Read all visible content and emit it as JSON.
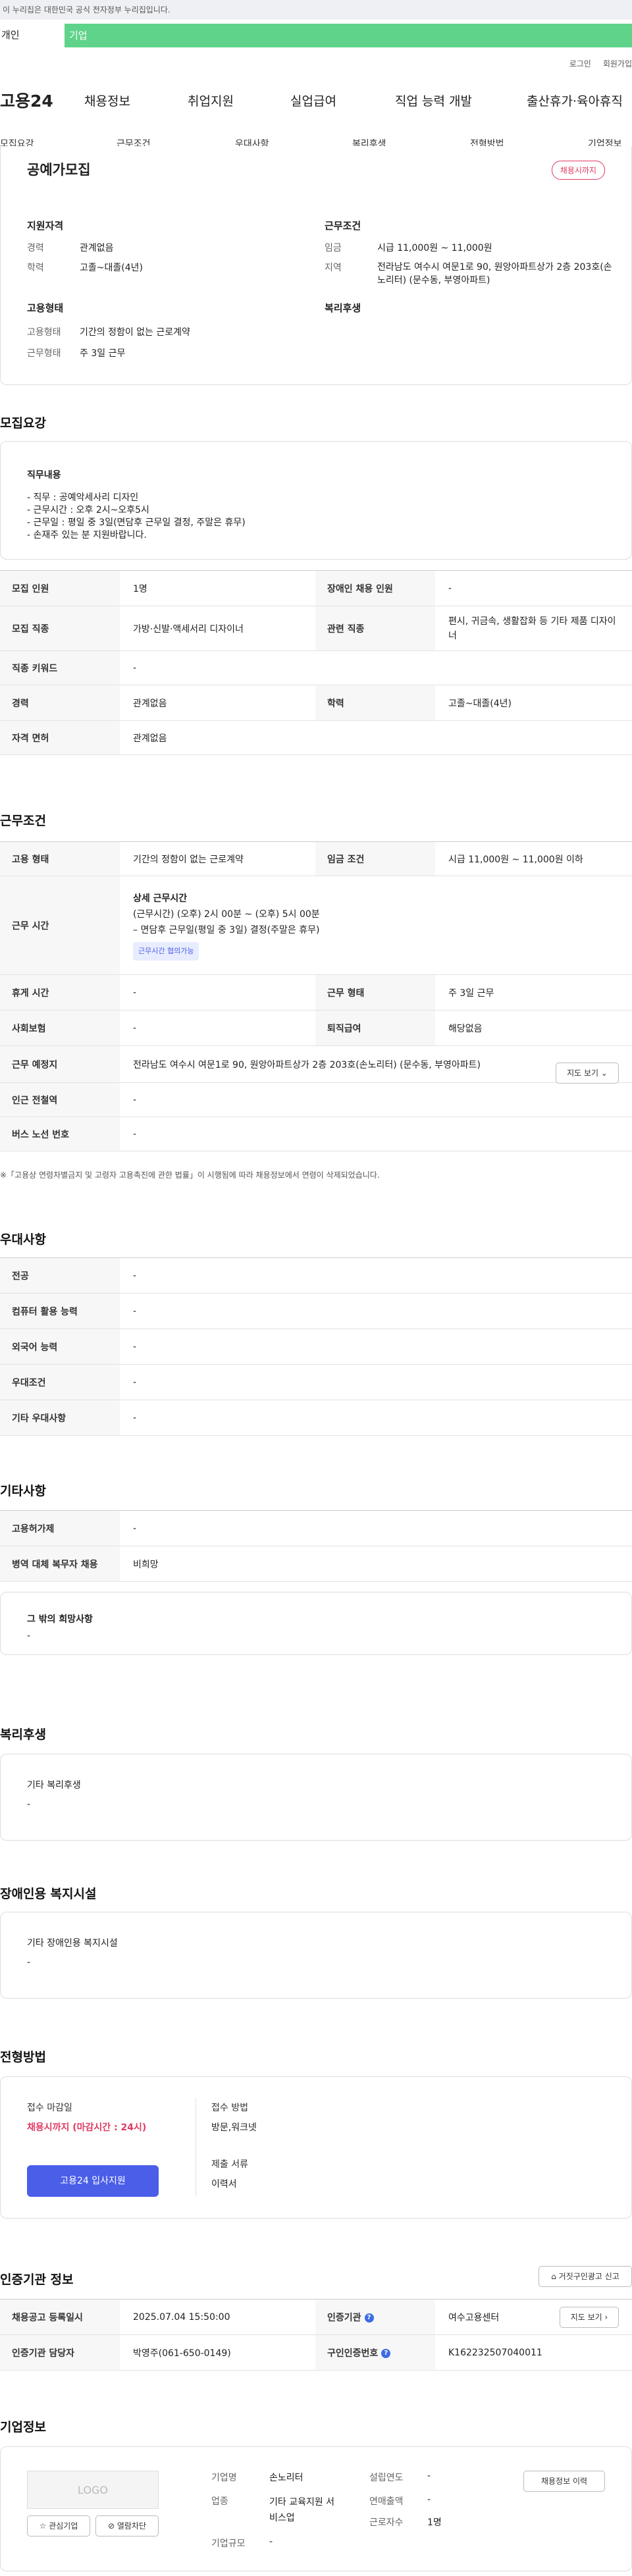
{
  "top": {
    "notice": "이 누리집은 대한민국 공식 전자정부 누리집입니다.",
    "tab_individual": "개인",
    "tab_business": "기업",
    "login": "로그인",
    "signup": "회원가입"
  },
  "gnb": {
    "logo": "고용24",
    "menu": [
      "채용정보",
      "취업지원",
      "실업급여",
      "직업 능력 개발",
      "출산휴가·육아휴직"
    ]
  },
  "subnav": [
    "모집요강",
    "근무조건",
    "우대사항",
    "복리후생",
    "전형방법",
    "기업정보"
  ],
  "summary": {
    "title": "공예가모집",
    "badge": "채용시까지",
    "qual_title": "지원자격",
    "career_label": "경력",
    "career": "관계없음",
    "edu_label": "학력",
    "edu": "고졸~대졸(4년)",
    "work_title": "근무조건",
    "wage_label": "임금",
    "wage": "시급 11,000원 ~ 11,000원",
    "area_label": "지역",
    "area": "전라남도 여수시 여문1로 90, 원앙아파트상가 2층 203호(손노리터) (문수동, 부영아파트)",
    "emp_title": "고용형태",
    "emp_type_label": "고용형태",
    "emp_type": "기간의 정함이 없는 근로계약",
    "work_form_label": "근무형태",
    "work_form": "주 3일 근무",
    "welfare_title": "복리후생"
  },
  "recruit": {
    "title": "모집요강",
    "duty_title": "직무내용",
    "duty_lines": [
      "- 직무 : 공예악세사리 디자인",
      "- 근무시간 : 오후 2시~오후5시",
      "- 근무일 : 평일 중 3일(면담후 근무일 결정, 주말은 휴무)",
      "- 손재주 있는 분 지원바랍니다."
    ],
    "rows": [
      [
        "모집 인원",
        "1명",
        "장애인 채용 인원",
        "-"
      ],
      [
        "모집 직종",
        "가방·신발·액세서리 디자이너",
        "관련 직종",
        "편시, 귀금속, 생활잡화 등 기타 제품 디자이너"
      ]
    ],
    "rows2": [
      [
        "직종 키워드",
        "-"
      ]
    ],
    "rows3": [
      [
        "경력",
        "관계없음",
        "학력",
        "고졸~대졸(4년)"
      ]
    ],
    "rows4": [
      [
        "자격 면허",
        "관계없음"
      ]
    ]
  },
  "conditions": {
    "title": "근무조건",
    "emp_label": "고용 형태",
    "emp": "기간의 정함이 없는 근로계약",
    "wage_cond_label": "임금 조건",
    "wage_cond": "시급 11,000원 ~ 11,000원 이하",
    "time_label": "근무 시간",
    "time_head": "상세 근무시간",
    "time_line1": "(근무시간) (오후) 2시 00분 ~ (오후) 5시 00분",
    "time_line2": "– 면담후 근무일(평일 중 3일) 결정(주말은 휴무)",
    "time_badge": "근무시간 협의가능",
    "rest_label": "휴게 시간",
    "rest": "-",
    "form_label": "근무 형태",
    "form": "주 3일 근무",
    "ins_label": "사회보험",
    "ins": "-",
    "retire_label": "퇴직급여",
    "retire": "해당없음",
    "place_label": "근무 예정지",
    "place": "전라남도 여수시 여문1로 90, 원앙아파트상가 2층 203호(손노리터) (문수동, 부영아파트)",
    "map_btn": "지도 보기",
    "station_label": "인근 전철역",
    "station": "-",
    "bus_label": "버스 노선 번호",
    "bus": "-",
    "note": "※「고용상 연령차별금지 및 고령자 고용촉진에 관한 법률」이 시행됨에 따라 채용정보에서 연령이 삭제되었습니다."
  },
  "pref": {
    "title": "우대사항",
    "rows": [
      [
        "전공",
        "-"
      ],
      [
        "컴퓨터 활용 능력",
        "-"
      ],
      [
        "외국어 능력",
        "-"
      ],
      [
        "우대조건",
        "-"
      ],
      [
        "기타 우대사항",
        "-"
      ]
    ]
  },
  "etc": {
    "title": "기타사항",
    "rows": [
      [
        "고용허가제",
        "-"
      ],
      [
        "병역 대체 복무자 채용",
        "비희망"
      ]
    ],
    "hope_title": "그 밖의 희망사항",
    "hope": "-"
  },
  "welfare": {
    "title": "복리후생",
    "sub": "기타 복리후생",
    "val": "-"
  },
  "disabled": {
    "title": "장애인용 복지시설",
    "sub": "기타 장애인용 복지시설",
    "val": "-"
  },
  "selection": {
    "title": "전형방법",
    "deadline_label": "접수 마감일",
    "deadline": "채용시까지 (마감시간 : 24시)",
    "apply_btn": "고용24 입사지원",
    "method_label": "접수 방법",
    "method": "방문,워크넷",
    "docs_label": "제출 서류",
    "docs": "이력서"
  },
  "agency": {
    "title": "인증기관 정보",
    "report_btn": "거짓구인광고 신고",
    "reg_label": "채용공고 등록일시",
    "reg": "2025.07.04 15:50:00",
    "agency_label": "인증기관",
    "agency": "여수고용센터",
    "map_btn": "지도 보기",
    "manager_label": "인증기관 담당자",
    "manager": "박영주(061-650-0149)",
    "cert_label": "구인인증번호",
    "cert": "K162232507040011"
  },
  "company": {
    "title": "기업정보",
    "logo": "LOGO",
    "fav_btn": "관심기업",
    "block_btn": "열람차단",
    "history_btn": "채용정보 이력",
    "name_label": "기업명",
    "name": "손노리터",
    "year_label": "설립연도",
    "year": "-",
    "industry_label": "업종",
    "industry": "기타 교육지원 서비스업",
    "sales_label": "연매출액",
    "sales": "-",
    "size_label": "기업규모",
    "size": "-",
    "emp_label": "근로자수",
    "emp": "1명"
  },
  "colors": {
    "accent": "#4a5ee8",
    "green": "#5fd38a",
    "badge": "#e03a62"
  }
}
